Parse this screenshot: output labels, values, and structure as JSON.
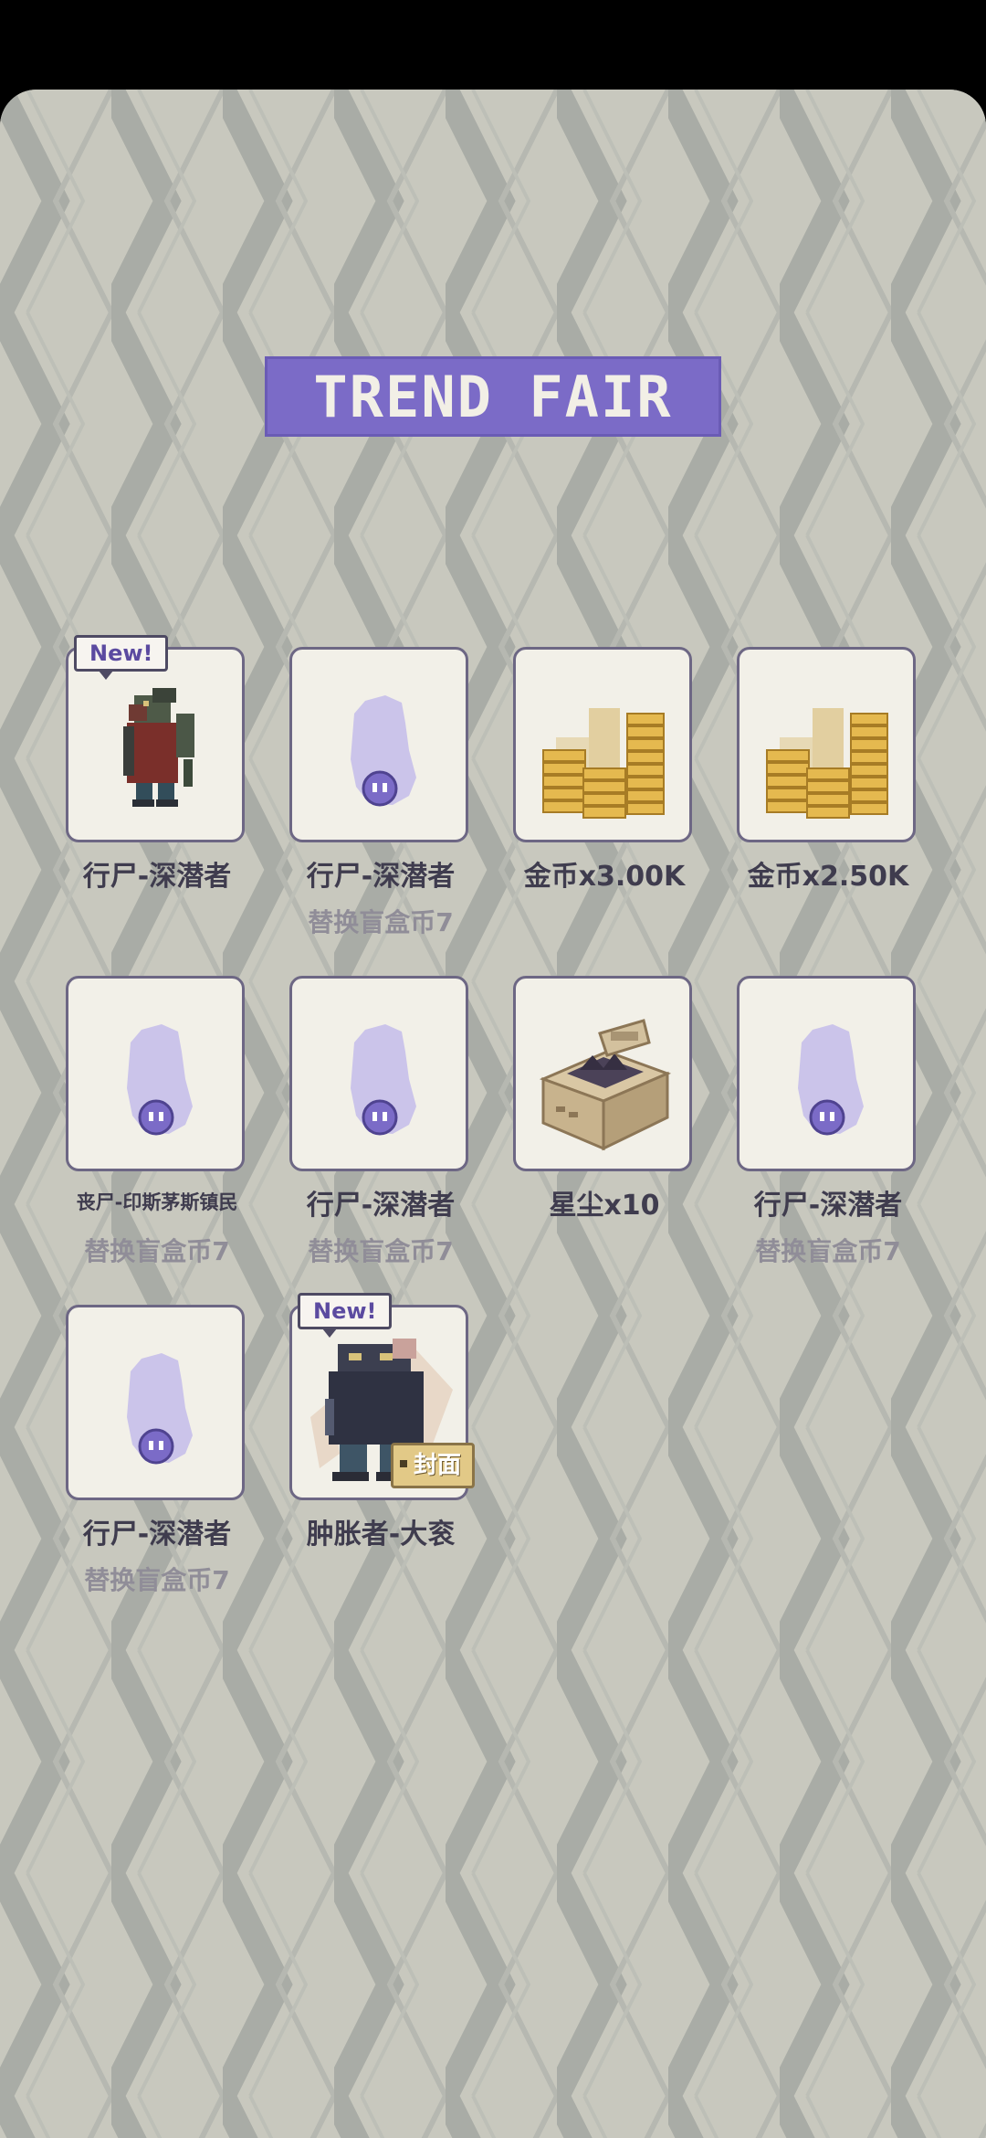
{
  "header": {
    "title": "TREND FAIR"
  },
  "items": [
    {
      "name": "行尸-深潜者",
      "sub": "",
      "new": "New!",
      "art": "zombie-diver-icon"
    },
    {
      "name": "行尸-深潜者",
      "sub": "替换盲盒币7",
      "art": "ghost-icon"
    },
    {
      "name": "金币x3.00K",
      "sub": "",
      "art": "coins-icon"
    },
    {
      "name": "金币x2.50K",
      "sub": "",
      "art": "coins-icon"
    },
    {
      "name": "丧尸-印斯茅斯镇民",
      "sub": "替换盲盒币7",
      "art": "ghost-icon"
    },
    {
      "name": "行尸-深潜者",
      "sub": "替换盲盒币7",
      "art": "ghost-icon"
    },
    {
      "name": "星尘x10",
      "sub": "",
      "art": "stardust-box-icon"
    },
    {
      "name": "行尸-深潜者",
      "sub": "替换盲盒币7",
      "art": "ghost-icon"
    },
    {
      "name": "行尸-深潜者",
      "sub": "替换盲盒币7",
      "art": "ghost-icon"
    },
    {
      "name": "肿胀者-大衮",
      "sub": "",
      "new": "New!",
      "cover": "封面",
      "art": "bloated-dagon-icon"
    }
  ],
  "colors": {
    "background": "#c8c8be",
    "zigzag": "#a9aca6",
    "title_bg": "#7b6bc7",
    "card_bg": "#f2f0e8",
    "card_border": "#6d6784",
    "text": "#3f3c4e",
    "subtext": "#908d98"
  }
}
